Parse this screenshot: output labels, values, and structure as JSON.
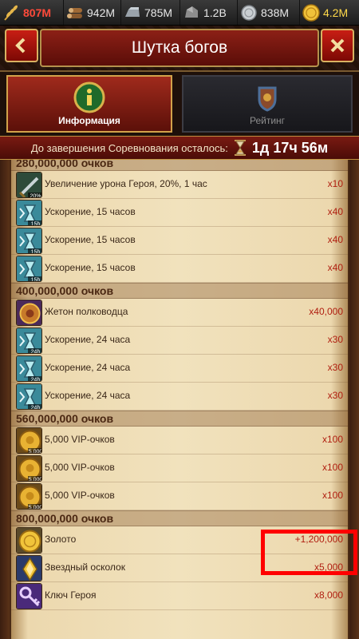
{
  "resources": [
    {
      "icon": "wheat-icon",
      "value": "807M",
      "color": "#ff4a3a"
    },
    {
      "icon": "wood-icon",
      "value": "942M"
    },
    {
      "icon": "iron-icon",
      "value": "785M"
    },
    {
      "icon": "stone-icon",
      "value": "1.2B"
    },
    {
      "icon": "silver-icon",
      "value": "838M"
    },
    {
      "icon": "gold-icon",
      "value": "4.2M"
    }
  ],
  "header": {
    "title": "Шутка богов",
    "back_icon": "chevron-left-icon",
    "close_icon": "close-icon"
  },
  "tabs": [
    {
      "label": "Информация",
      "active": true,
      "icon": "info-icon"
    },
    {
      "label": "Рейтинг",
      "active": false,
      "icon": "crest-icon"
    }
  ],
  "timer": {
    "label": "До завершения Соревнования осталось:",
    "value": "1д 17ч 56м"
  },
  "tiers": [
    {
      "label": "280,000,000 очков",
      "items": [
        {
          "icon": "sword-icon",
          "badge": "20%",
          "name": "Увеличение урона Героя, 20%, 1 час",
          "qty": "x10"
        },
        {
          "icon": "speedup-icon",
          "badge": "15h",
          "name": "Ускорение, 15 часов",
          "qty": "x40"
        },
        {
          "icon": "speedup-icon",
          "badge": "15h",
          "name": "Ускорение, 15 часов",
          "qty": "x40"
        },
        {
          "icon": "speedup-icon",
          "badge": "15h",
          "name": "Ускорение, 15 часов",
          "qty": "x40"
        }
      ]
    },
    {
      "label": "400,000,000 очков",
      "items": [
        {
          "icon": "commander-token-icon",
          "badge": "",
          "name": "Жетон полководца",
          "qty": "x40,000"
        },
        {
          "icon": "speedup-icon",
          "badge": "24h",
          "name": "Ускорение, 24 часа",
          "qty": "x30"
        },
        {
          "icon": "speedup-icon",
          "badge": "24h",
          "name": "Ускорение, 24 часа",
          "qty": "x30"
        },
        {
          "icon": "speedup-icon",
          "badge": "24h",
          "name": "Ускорение, 24 часа",
          "qty": "x30"
        }
      ]
    },
    {
      "label": "560,000,000 очков",
      "items": [
        {
          "icon": "vip-coin-icon",
          "badge": "5,000",
          "name": "5,000 VIP-очков",
          "qty": "x100"
        },
        {
          "icon": "vip-coin-icon",
          "badge": "5,000",
          "name": "5,000 VIP-очков",
          "qty": "x100"
        },
        {
          "icon": "vip-coin-icon",
          "badge": "5,000",
          "name": "5,000 VIP-очков",
          "qty": "x100"
        }
      ]
    },
    {
      "label": "800,000,000 очков",
      "items": [
        {
          "icon": "gold-coin-icon",
          "badge": "",
          "name": "Золото",
          "qty": "+1,200,000"
        },
        {
          "icon": "star-shard-icon",
          "badge": "",
          "name": "Звездный осколок",
          "qty": "x5,000"
        },
        {
          "icon": "hero-key-icon",
          "badge": "",
          "name": "Ключ Героя",
          "qty": "x8,000"
        }
      ]
    }
  ]
}
